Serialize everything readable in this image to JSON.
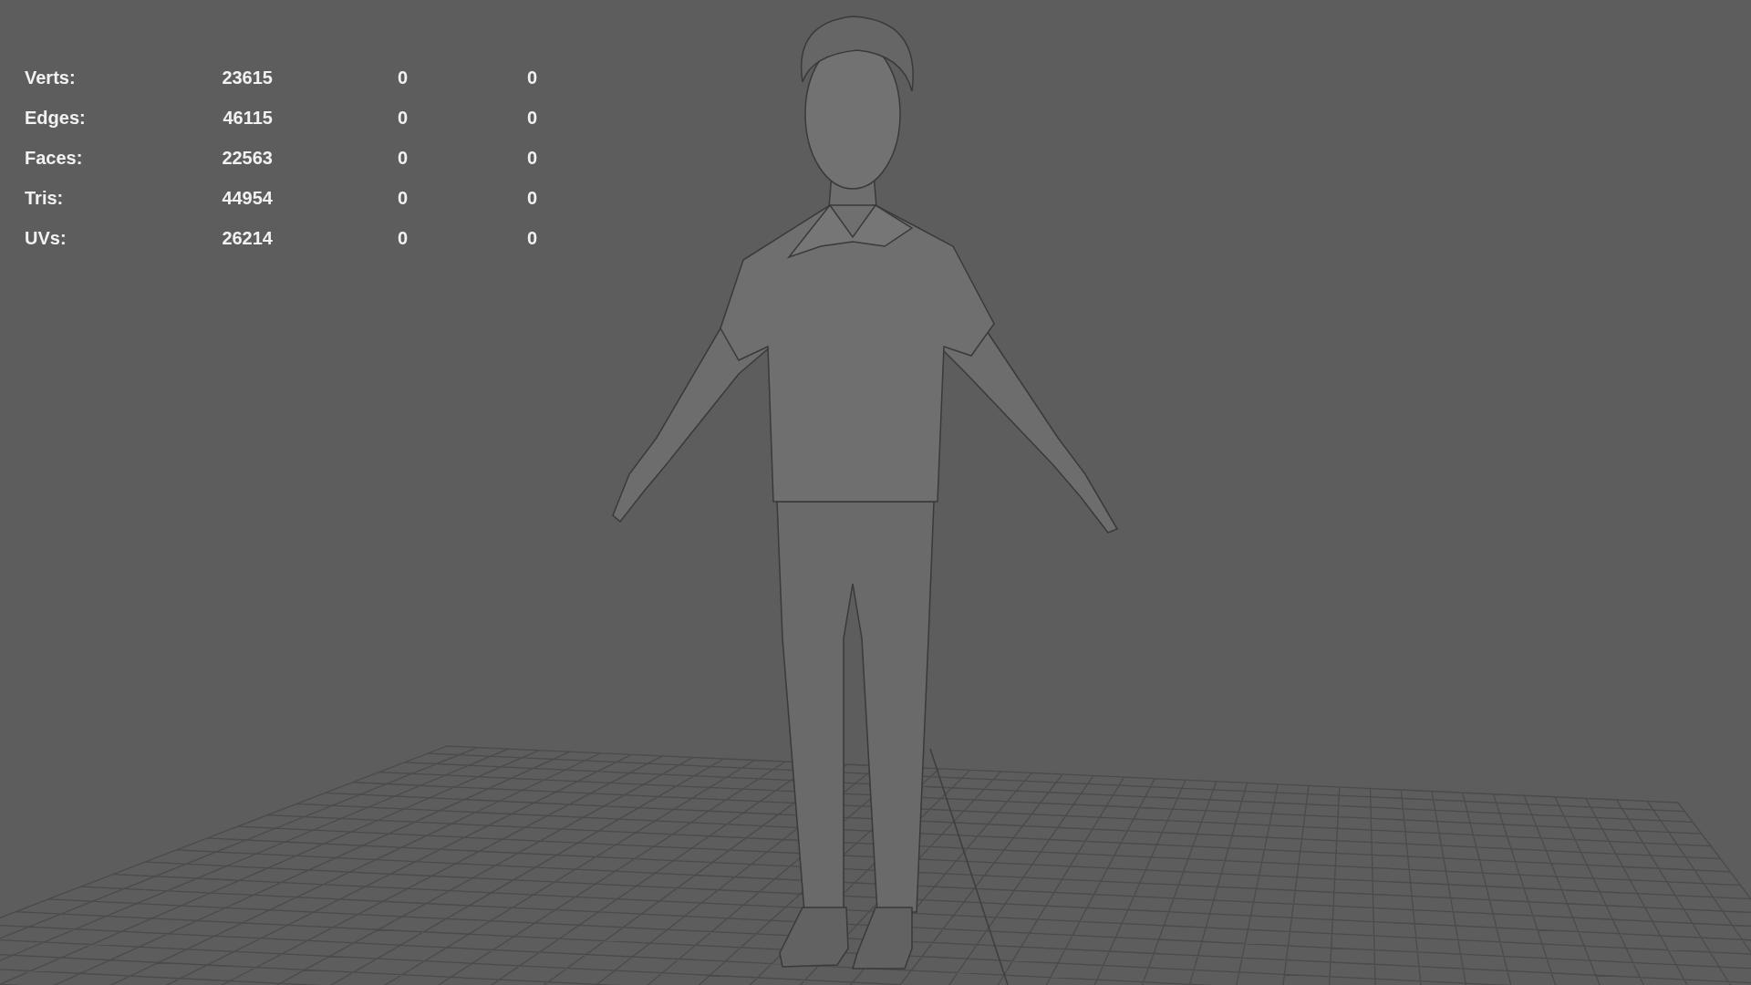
{
  "stats": [
    {
      "label": "Verts:",
      "values": [
        "23615",
        "0",
        "0"
      ]
    },
    {
      "label": "Edges:",
      "values": [
        "46115",
        "0",
        "0"
      ]
    },
    {
      "label": "Faces:",
      "values": [
        "22563",
        "0",
        "0"
      ]
    },
    {
      "label": "Tris:",
      "values": [
        "44954",
        "0",
        "0"
      ]
    },
    {
      "label": "UVs:",
      "values": [
        "26214",
        "0",
        "0"
      ]
    }
  ]
}
